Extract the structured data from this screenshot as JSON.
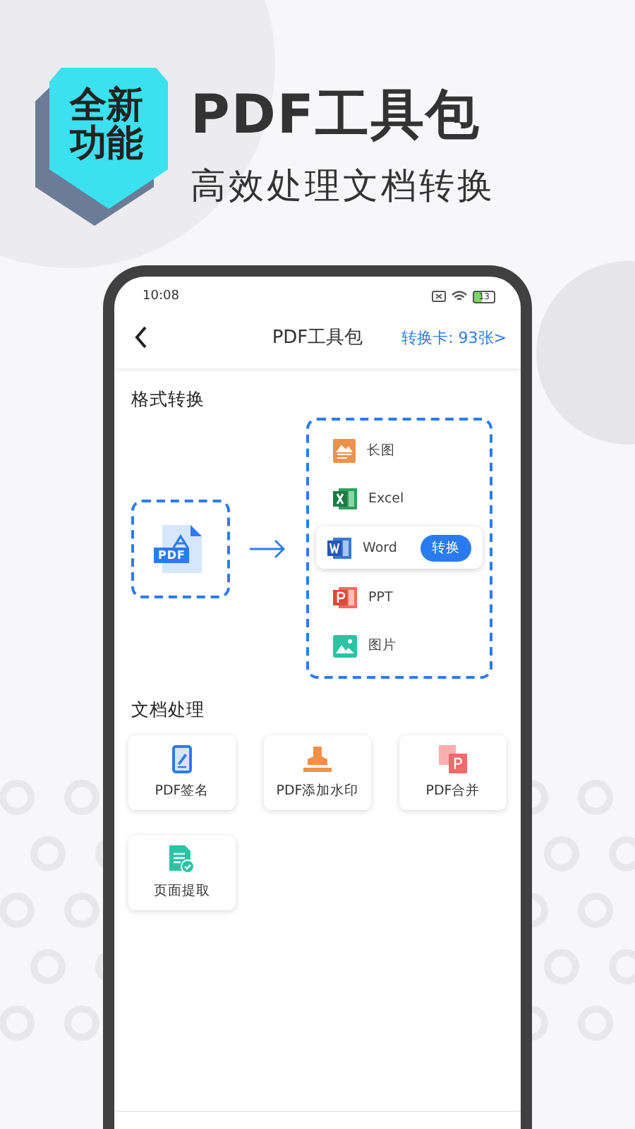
{
  "promo": {
    "badge": "全新功能",
    "title": "PDF工具包",
    "subtitle": "高效处理文档转换"
  },
  "status_bar": {
    "time": "10:08",
    "battery": "13"
  },
  "nav": {
    "title": "PDF工具包",
    "link": "转换卡: 93张>"
  },
  "format_conversion": {
    "heading": "格式转换",
    "source": "PDF",
    "targets": [
      {
        "kind": "image-long",
        "label": "长图",
        "selected": false
      },
      {
        "kind": "excel",
        "label": "Excel",
        "selected": false
      },
      {
        "kind": "word",
        "label": "Word",
        "selected": true
      },
      {
        "kind": "ppt",
        "label": "PPT",
        "selected": false
      },
      {
        "kind": "picture",
        "label": "图片",
        "selected": false
      }
    ],
    "action": "转换"
  },
  "document_tools": {
    "heading": "文档处理",
    "items": [
      {
        "kind": "sign",
        "label": "PDF签名"
      },
      {
        "kind": "watermark",
        "label": "PDF添加水印"
      },
      {
        "kind": "merge",
        "label": "PDF合并"
      },
      {
        "kind": "extract",
        "label": "页面提取"
      }
    ]
  }
}
